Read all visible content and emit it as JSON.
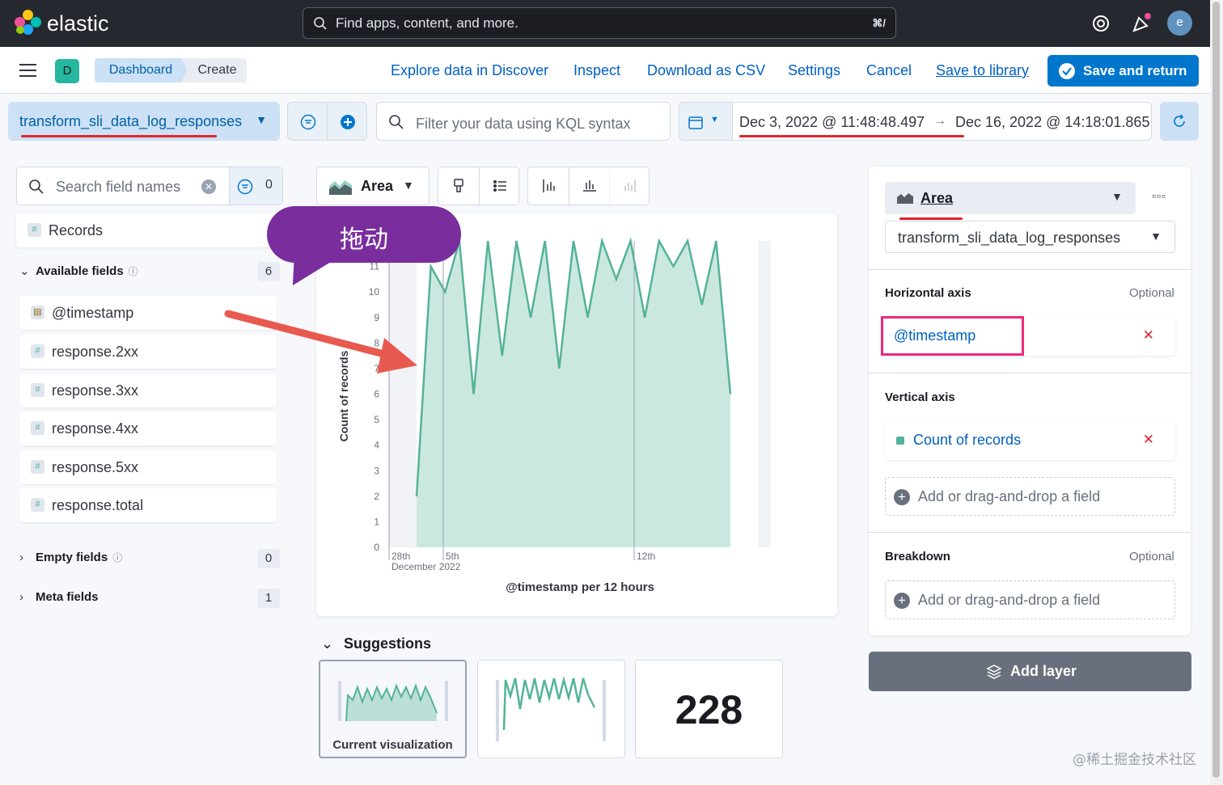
{
  "header": {
    "brand": "elastic",
    "search_placeholder": "Find apps, content, and more.",
    "search_shortcut": "⌘/",
    "avatar_initial": "e"
  },
  "appbar": {
    "space_initial": "D",
    "breadcrumbs": [
      "Dashboard",
      "Create"
    ],
    "links": [
      "Explore data in Discover",
      "Inspect",
      "Download as CSV",
      "Settings",
      "Cancel",
      "Save to library"
    ],
    "save_return_label": "Save and return"
  },
  "querybar": {
    "data_view": "transform_sli_data_log_responses",
    "kql_placeholder": "Filter your data using KQL syntax",
    "start_date": "Dec 3, 2022 @ 11:48:48.497",
    "arrow": "→",
    "end_date": "Dec 16, 2022 @ 14:18:01.865"
  },
  "fields": {
    "search_placeholder": "Search field names",
    "filter_count": "0",
    "records_label": "Records",
    "available_label": "Available fields",
    "available_count": "6",
    "available": [
      {
        "name": "@timestamp",
        "type": "date"
      },
      {
        "name": "response.2xx",
        "type": "number"
      },
      {
        "name": "response.3xx",
        "type": "number"
      },
      {
        "name": "response.4xx",
        "type": "number"
      },
      {
        "name": "response.5xx",
        "type": "number"
      },
      {
        "name": "response.total",
        "type": "number"
      }
    ],
    "empty_label": "Empty fields",
    "empty_count": "0",
    "meta_label": "Meta fields",
    "meta_count": "1"
  },
  "toolbar": {
    "chart_type": "Area"
  },
  "annotation": {
    "callout_text": "拖动"
  },
  "chart_data": {
    "type": "area",
    "title": "",
    "xlabel": "@timestamp per 12 hours",
    "ylabel": "Count of records",
    "ylim": [
      0,
      12
    ],
    "y_ticks": [
      "0",
      "1",
      "2",
      "3",
      "4",
      "5",
      "6",
      "7",
      "8",
      "9",
      "10",
      "11"
    ],
    "x_tick_labels": [
      "28th\nDecember 2022",
      "5th",
      "12th"
    ],
    "x_tick_main": [
      "28th",
      "5th",
      "12th"
    ],
    "x_tick_sub": "December 2022",
    "color": "#54b399",
    "values": [
      2,
      11,
      10,
      12,
      6,
      12,
      7.5,
      12,
      9,
      12,
      7,
      12,
      9,
      12,
      10.5,
      12,
      9,
      12,
      11,
      12,
      9.5,
      12,
      6
    ]
  },
  "suggestions": {
    "title": "Suggestions",
    "current_label": "Current visualization",
    "metric_value": "228"
  },
  "config": {
    "vis_type": "Area",
    "layer_source": "transform_sli_data_log_responses",
    "horizontal_axis_label": "Horizontal axis",
    "optional_label": "Optional",
    "horizontal_field": "@timestamp",
    "vertical_axis_label": "Vertical axis",
    "vertical_field": "Count of records",
    "dropzone_label": "Add or drag-and-drop a field",
    "breakdown_label": "Breakdown",
    "add_layer_label": "Add layer"
  },
  "watermark": "@稀土掘金技术社区",
  "colors": {
    "accent": "#0077cc",
    "series": "#54b399",
    "annotation_red": "#e0242a",
    "callout_purple": "#7a2e9e",
    "highlight_pink": "#ee2a7b"
  }
}
